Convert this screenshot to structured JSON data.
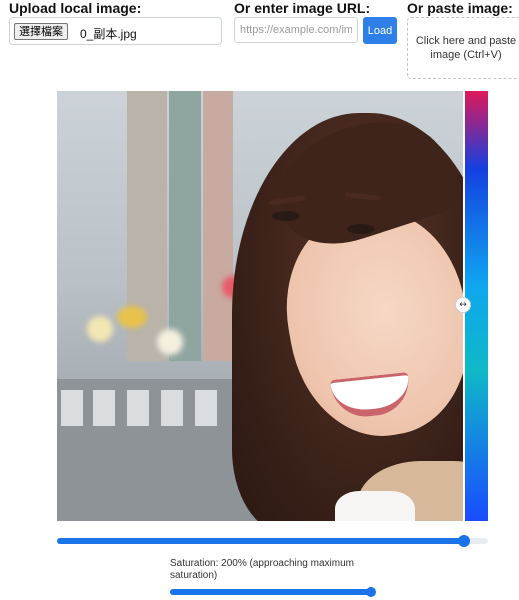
{
  "upload": {
    "label": "Upload local image:",
    "button_label": "選擇檔案",
    "file_name": "0_副本.jpg"
  },
  "url": {
    "label": "Or enter image URL:",
    "placeholder": "https://example.com/im",
    "load_label": "Load"
  },
  "paste": {
    "label": "Or paste image:",
    "text": "Click here and paste image (Ctrl+V)"
  },
  "comparison": {
    "handle_icon": "↔",
    "divider_position_percent": 94.5
  },
  "compare_slider": {
    "value_percent": 94.5
  },
  "saturation": {
    "label": "Saturation: 200% (approaching maximum saturation)",
    "value_percent": 100
  },
  "colors": {
    "accent": "#1a73e8",
    "load_button": "#2f7fe8"
  }
}
